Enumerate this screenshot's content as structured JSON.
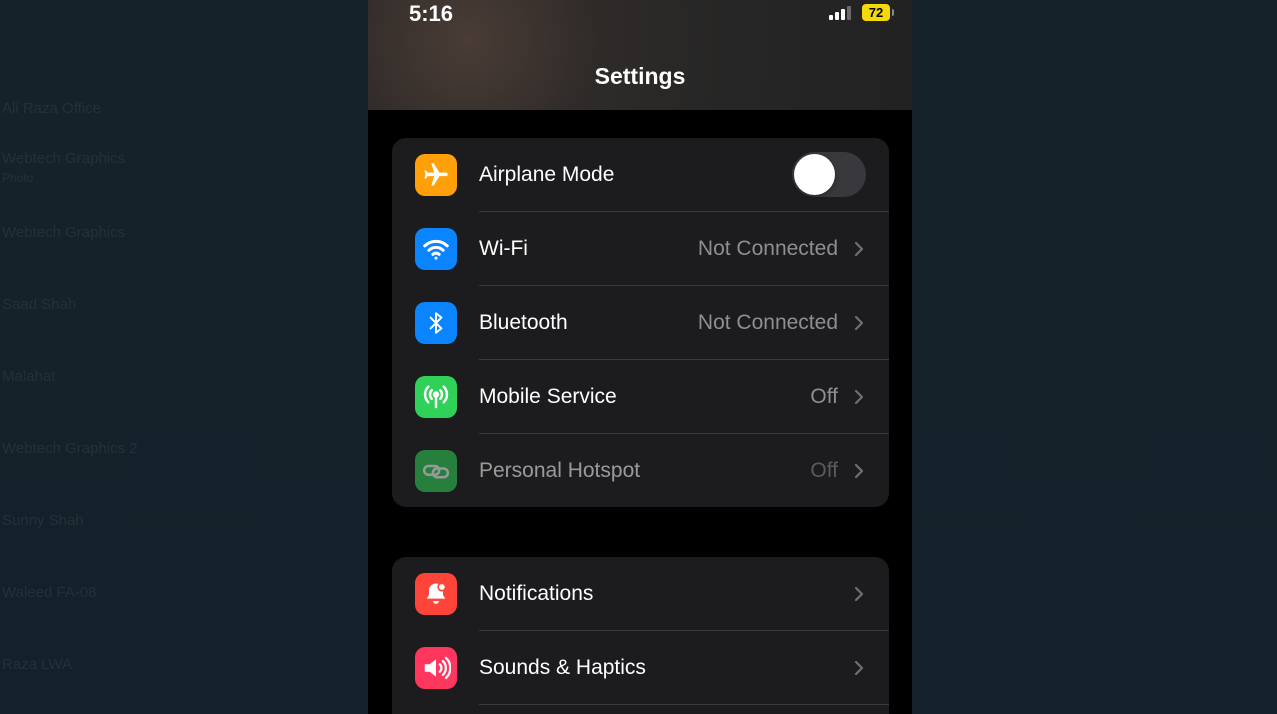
{
  "status_bar": {
    "time": "5:16",
    "battery_level": "72"
  },
  "nav": {
    "title": "Settings"
  },
  "group_connectivity": [
    {
      "id": "airplane",
      "label": "Airplane Mode",
      "value": "",
      "icon": "airplane-icon",
      "color": "#ff9f0a",
      "toggle_on": false
    },
    {
      "id": "wifi",
      "label": "Wi-Fi",
      "value": "Not Connected",
      "icon": "wifi-icon",
      "color": "#0a84ff"
    },
    {
      "id": "bluetooth",
      "label": "Bluetooth",
      "value": "Not Connected",
      "icon": "bluetooth-icon",
      "color": "#0a84ff"
    },
    {
      "id": "mobile",
      "label": "Mobile Service",
      "value": "Off",
      "icon": "antenna-icon",
      "color": "#30d158"
    },
    {
      "id": "hotspot",
      "label": "Personal Hotspot",
      "value": "Off",
      "icon": "link-icon",
      "color": "#30d158",
      "disabled": true
    }
  ],
  "group_system": [
    {
      "id": "notifications",
      "label": "Notifications",
      "value": "",
      "icon": "bell-icon",
      "color": "#ff453a"
    },
    {
      "id": "sounds",
      "label": "Sounds & Haptics",
      "value": "",
      "icon": "speaker-icon",
      "color": "#ff375f"
    }
  ],
  "background_chat_list": [
    {
      "name": "Ali Raza Office",
      "preview": "Photo"
    },
    {
      "name": "Webtech Graphics",
      "preview": ""
    },
    {
      "name": "Saad Shah",
      "preview": ""
    },
    {
      "name": "Malahat",
      "preview": ""
    },
    {
      "name": "Webtech Graphics 2",
      "preview": ""
    },
    {
      "name": "Sunny Shah",
      "preview": ""
    },
    {
      "name": "Waleed FA-08",
      "preview": ""
    },
    {
      "name": "Raza LWA",
      "preview": ""
    }
  ]
}
